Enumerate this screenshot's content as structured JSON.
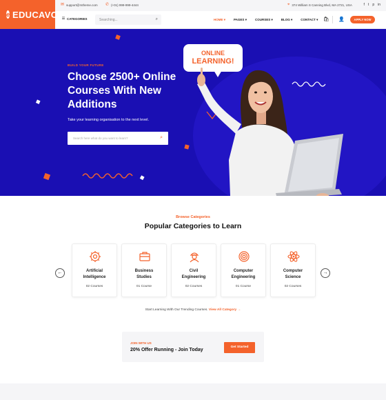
{
  "brand": {
    "name": "EDUCAVO",
    "mark": "e"
  },
  "topbar": {
    "email": "support@rstheme.com",
    "phone": "(+01) 999-999-4444",
    "address": "374 William S Canning Blvd, MA 2721, USA",
    "socials": [
      "f",
      "t",
      "p",
      "in"
    ]
  },
  "nav": {
    "categories_label": "CATEGORIES",
    "search_placeholder": "Searching...",
    "menu": [
      {
        "label": "HOME",
        "active": true
      },
      {
        "label": "PAGES",
        "active": false
      },
      {
        "label": "COURSES",
        "active": false
      },
      {
        "label": "BLOG",
        "active": false
      },
      {
        "label": "CONTACT",
        "active": false
      }
    ],
    "apply_label": "APPLY NOW"
  },
  "hero": {
    "eyebrow": "BUILD YOUR FUTURE",
    "title": "Choose 2500+ Online Courses With New Additions",
    "subtitle": "Take your learning organisation to the next level.",
    "search_placeholder": "Search here what do you want to learn?",
    "speech_line1": "ONLINE",
    "speech_line2": "LEARNING!"
  },
  "categories": {
    "eyebrow": "Browse Categories",
    "title": "Popular Categories to Learn",
    "items": [
      {
        "name_1": "Artificial",
        "name_2": "Intelligence",
        "count": "02 Courses",
        "icon": "ai-gear-icon"
      },
      {
        "name_1": "Business",
        "name_2": "Studies",
        "count": "01 Course",
        "icon": "briefcase-icon"
      },
      {
        "name_1": "Civil",
        "name_2": "Engineering",
        "count": "02 Courses",
        "icon": "engineer-icon"
      },
      {
        "name_1": "Computer",
        "name_2": "Engineering",
        "count": "01 Course",
        "icon": "fingerprint-icon"
      },
      {
        "name_1": "Computer",
        "name_2": "Science",
        "count": "02 Courses",
        "icon": "atom-icon"
      }
    ],
    "trending_text": "Start Learning With Our Trending Courses.",
    "trending_link": "View All Category"
  },
  "offer": {
    "eyebrow": "JOIN WITH US",
    "headline": "20% Offer Running - Join Today",
    "button": "Get Started"
  },
  "colors": {
    "accent": "#f4622b",
    "hero_bg": "#1a0fb3"
  }
}
